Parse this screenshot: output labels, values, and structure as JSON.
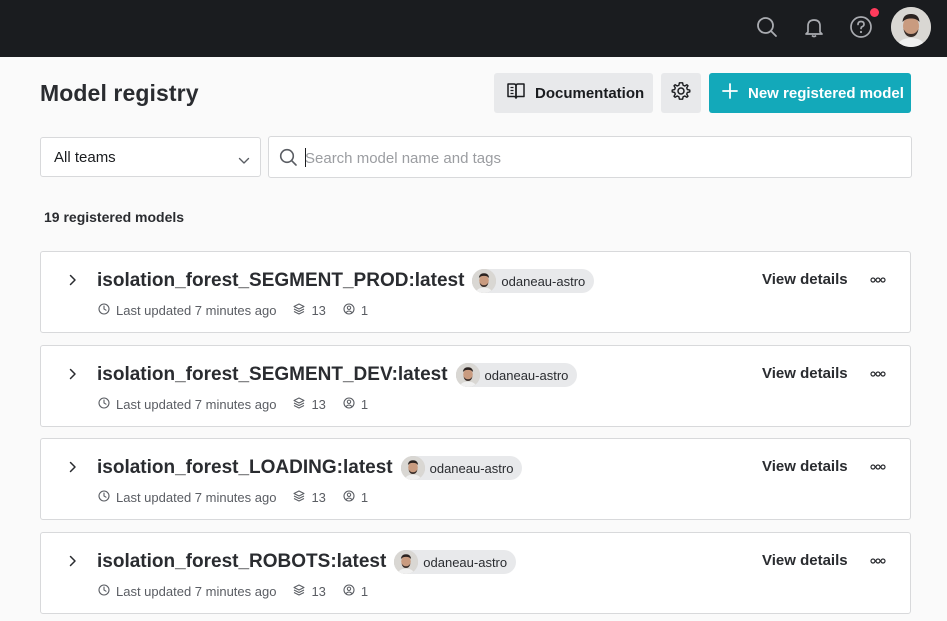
{
  "topbar": {
    "icons": [
      "search-icon",
      "bell-icon",
      "help-icon"
    ],
    "notification_dot_color": "#ff3b5c"
  },
  "header": {
    "title": "Model registry",
    "documentation_label": "Documentation",
    "new_model_label": "New registered model",
    "accent_color": "#13a9ba"
  },
  "filters": {
    "team_selected": "All teams",
    "search_placeholder": "Search model name and tags",
    "search_value": ""
  },
  "summary": {
    "count_label": "19 registered models"
  },
  "models": [
    {
      "name": "isolation_forest_SEGMENT_PROD:latest",
      "owner": "odaneau-astro",
      "updated": "Last updated 7 minutes ago",
      "versions": "13",
      "users": "1",
      "action_label": "View details"
    },
    {
      "name": "isolation_forest_SEGMENT_DEV:latest",
      "owner": "odaneau-astro",
      "updated": "Last updated 7 minutes ago",
      "versions": "13",
      "users": "1",
      "action_label": "View details"
    },
    {
      "name": "isolation_forest_LOADING:latest",
      "owner": "odaneau-astro",
      "updated": "Last updated 7 minutes ago",
      "versions": "13",
      "users": "1",
      "action_label": "View details"
    },
    {
      "name": "isolation_forest_ROBOTS:latest",
      "owner": "odaneau-astro",
      "updated": "Last updated 7 minutes ago",
      "versions": "13",
      "users": "1",
      "action_label": "View details"
    }
  ]
}
